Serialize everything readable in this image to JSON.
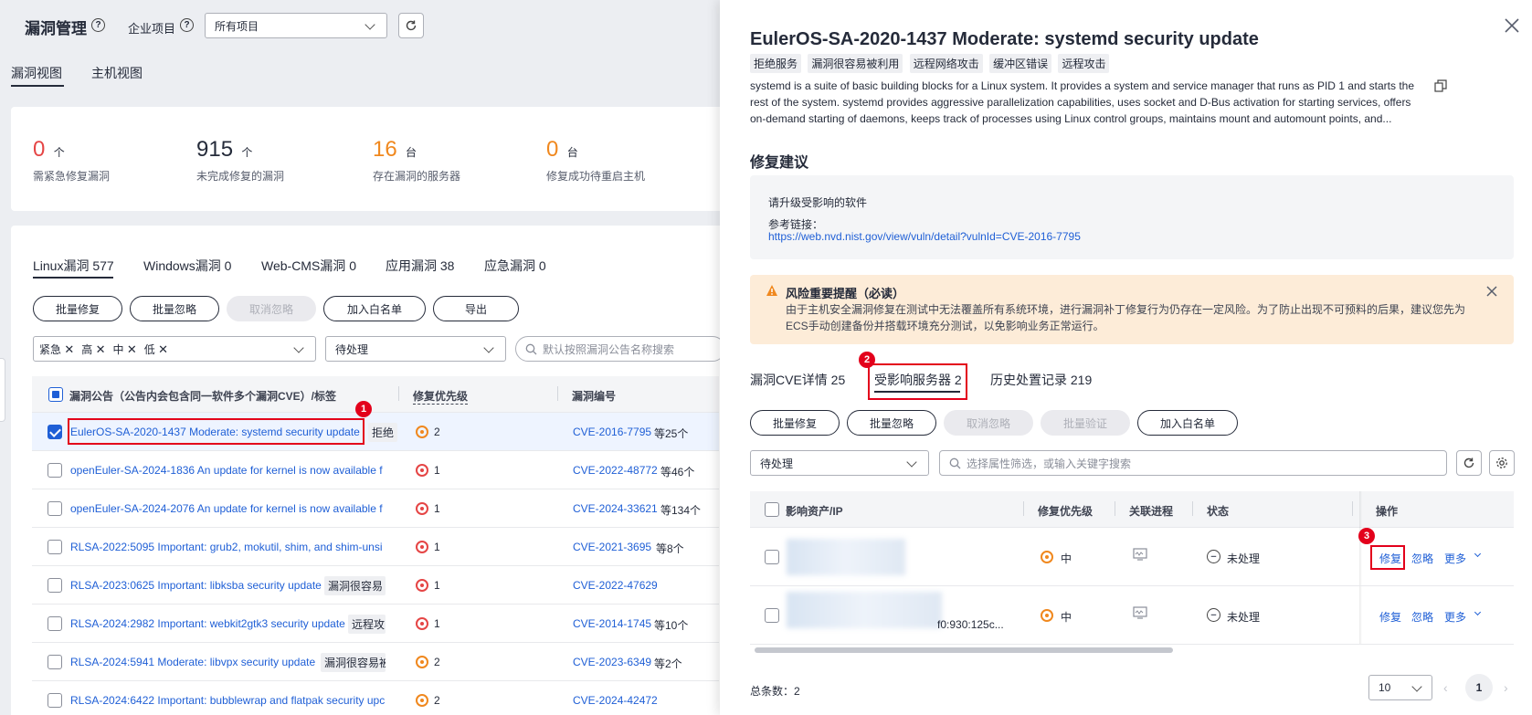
{
  "header": {
    "title": "漏洞管理",
    "enterprise_label": "企业项目",
    "project_select": "所有项目"
  },
  "view_tabs": [
    "漏洞视图",
    "主机视图"
  ],
  "stats": [
    {
      "value": "0",
      "unit": "个",
      "label": "需紧急修复漏洞",
      "color": "#e54545"
    },
    {
      "value": "915",
      "unit": "个",
      "label": "未完成修复的漏洞",
      "color": "#252b3a"
    },
    {
      "value": "16",
      "unit": "台",
      "label": "存在漏洞的服务器",
      "color": "#f0881e"
    },
    {
      "value": "0",
      "unit": "台",
      "label": "修复成功待重启主机",
      "color": "#f0881e"
    }
  ],
  "os_tabs": [
    "Linux漏洞 577",
    "Windows漏洞 0",
    "Web-CMS漏洞 0",
    "应用漏洞 38",
    "应急漏洞 0"
  ],
  "left_actions": [
    "批量修复",
    "批量忽略",
    "取消忽略",
    "加入白名单",
    "导出"
  ],
  "severity_chips": [
    "紧急",
    "高",
    "中",
    "低"
  ],
  "status_select": "待处理",
  "search_placeholder": "默认按照漏洞公告名称搜索",
  "table": {
    "headers": [
      "漏洞公告（公告内会包含同一软件多个漏洞CVE）/标签",
      "修复优先级",
      "漏洞编号"
    ],
    "rows": [
      {
        "name": "EulerOS-SA-2020-1437 Moderate: systemd security update",
        "tag": "拒绝",
        "priority": "2",
        "cve": "CVE-2016-7795",
        "more": "等25个",
        "checked": true
      },
      {
        "name": "openEuler-SA-2024-1836 An update for kernel is now available f",
        "tag": "",
        "priority": "1",
        "cve": "CVE-2022-48772",
        "more": "等46个",
        "checked": false
      },
      {
        "name": "openEuler-SA-2024-2076 An update for kernel is now available f",
        "tag": "",
        "priority": "1",
        "cve": "CVE-2024-33621",
        "more": "等134个",
        "checked": false
      },
      {
        "name": "RLSA-2022:5095 Important: grub2, mokutil, shim, and shim-unsi",
        "tag": "",
        "priority": "1",
        "cve": "CVE-2021-3695",
        "more": "等8个",
        "checked": false
      },
      {
        "name": "RLSA-2023:0625 Important: libksba security update",
        "tag": "漏洞很容易",
        "priority": "1",
        "cve": "CVE-2022-47629",
        "more": "",
        "checked": false
      },
      {
        "name": "RLSA-2024:2982 Important: webkit2gtk3 security update",
        "tag": "远程攻",
        "priority": "1",
        "cve": "CVE-2014-1745",
        "more": "等10个",
        "checked": false
      },
      {
        "name": "RLSA-2024:5941 Moderate: libvpx security update",
        "tag": "漏洞很容易被",
        "priority": "2",
        "cve": "CVE-2023-6349",
        "more": "等2个",
        "checked": false
      },
      {
        "name": "RLSA-2024:6422 Important: bubblewrap and flatpak security upc",
        "tag": "",
        "priority": "2",
        "cve": "CVE-2024-42472",
        "more": "",
        "checked": false
      }
    ]
  },
  "panel": {
    "title": "EulerOS-SA-2020-1437 Moderate: systemd security update",
    "tags": [
      "拒绝服务",
      "漏洞很容易被利用",
      "远程网络攻击",
      "缓冲区错误",
      "远程攻击"
    ],
    "description": "systemd is a suite of basic building blocks for a Linux system. It provides a system and service manager that runs as PID 1 and starts the rest of the system. systemd provides aggressive parallelization capabilities, uses socket and D-Bus activation for starting services, offers on-demand starting of daemons, keeps track of processes using Linux control groups, maintains mount and automount points, and...",
    "fix_title": "修复建议",
    "fix_text": "请升级受影响的软件",
    "ref_label": "参考链接：",
    "ref_link": "https://web.nvd.nist.gov/view/vuln/detail?vulnId=CVE-2016-7795",
    "risk_title": "风险重要提醒（必读）",
    "risk_text": "由于主机安全漏洞修复在测试中无法覆盖所有系统环境，进行漏洞补丁修复行为仍存在一定风险。为了防止出现不可预料的后果，建议您先为ECS手动创建备份并搭载环境充分测试，以免影响业务正常运行。",
    "tabs": [
      "漏洞CVE详情 25",
      "受影响服务器 2",
      "历史处置记录 219"
    ],
    "actions": [
      "批量修复",
      "批量忽略",
      "取消忽略",
      "批量验证",
      "加入白名单"
    ],
    "status_select": "待处理",
    "search_placeholder": "选择属性筛选，或输入关键字搜索",
    "table_headers": [
      "影响资产/IP",
      "修复优先级",
      "关联进程",
      "状态",
      "操作"
    ],
    "rows": [
      {
        "ip": "",
        "priority": "中",
        "status": "未处理",
        "ops": [
          "修复",
          "忽略",
          "更多"
        ]
      },
      {
        "ip": "f0:930:125c...",
        "priority": "中",
        "status": "未处理",
        "ops": [
          "修复",
          "忽略",
          "更多"
        ]
      }
    ],
    "total_label": "总条数：2",
    "page_size": "10",
    "page": "1"
  },
  "markers": [
    "1",
    "2",
    "3"
  ]
}
